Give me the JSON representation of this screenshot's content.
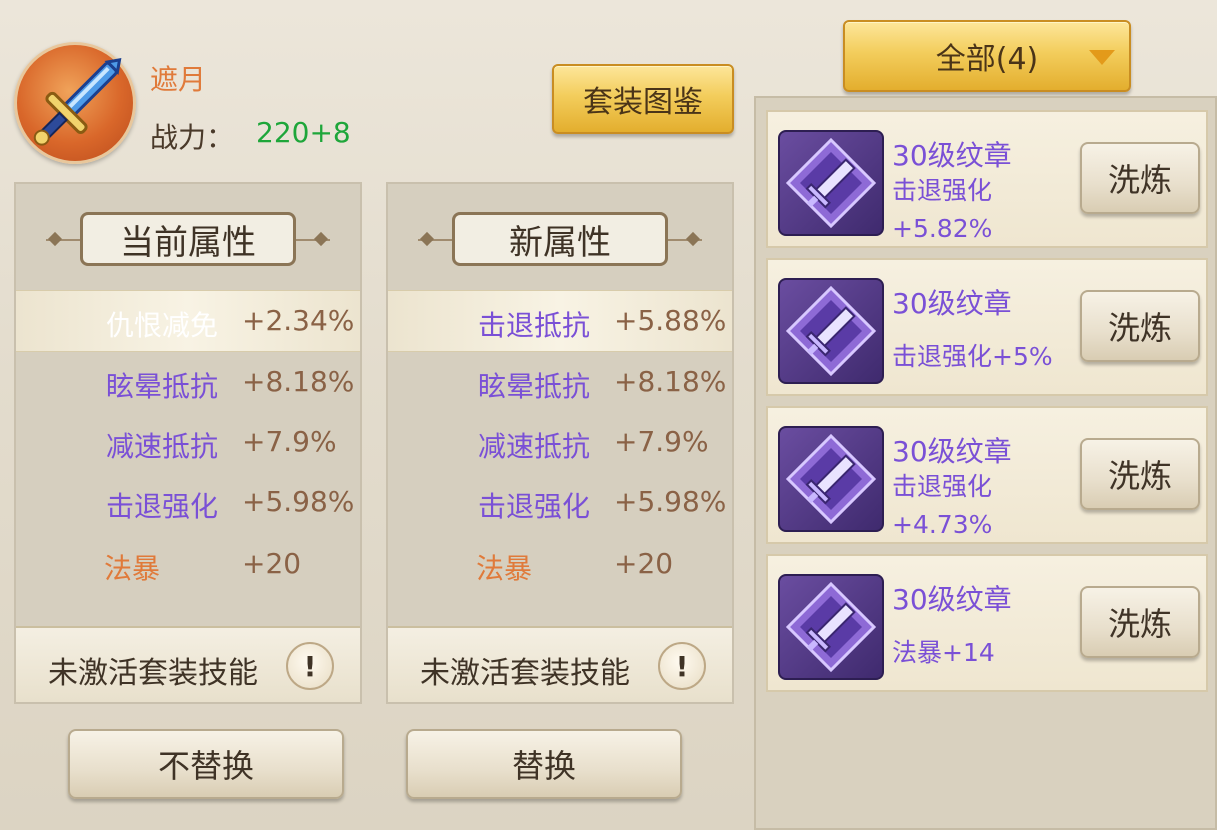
{
  "header": {
    "char_name": "遮月",
    "power_label": "战力：",
    "power_value": "220+8",
    "suit_button": "套装图鉴",
    "filter_label": "全部(4)"
  },
  "panels": {
    "current": {
      "title": "当前属性",
      "attrs": [
        {
          "name": "仇恨减免",
          "value": "+2.34%"
        },
        {
          "name": "眩晕抵抗",
          "value": "+8.18%"
        },
        {
          "name": "减速抵抗",
          "value": "+7.9%"
        },
        {
          "name": "击退强化",
          "value": "+5.98%"
        },
        {
          "name": "法暴",
          "value": "+20"
        }
      ],
      "skill_label": "未激活套装技能",
      "info_glyph": "!"
    },
    "new": {
      "title": "新属性",
      "attrs": [
        {
          "name": "击退抵抗",
          "value": "+5.88%"
        },
        {
          "name": "眩晕抵抗",
          "value": "+8.18%"
        },
        {
          "name": "减速抵抗",
          "value": "+7.9%"
        },
        {
          "name": "击退强化",
          "value": "+5.98%"
        },
        {
          "name": "法暴",
          "value": "+20"
        }
      ],
      "skill_label": "未激活套装技能",
      "info_glyph": "!"
    }
  },
  "buttons": {
    "no_replace": "不替换",
    "replace": "替换"
  },
  "items": [
    {
      "title": "30级纹章",
      "attr": "击退强化+5.82%",
      "button": "洗炼"
    },
    {
      "title": "30级纹章",
      "attr": "击退强化+5%",
      "button": "洗炼"
    },
    {
      "title": "30级纹章",
      "attr": "击退强化+4.73%",
      "button": "洗炼"
    },
    {
      "title": "30级纹章",
      "attr": "法暴+14",
      "button": "洗炼"
    }
  ],
  "colors": {
    "purple": "#7a50d6",
    "orange": "#e07a3a",
    "green": "#1ea63a",
    "gold": "#f3cd5c"
  },
  "icons": {
    "avatar": "sword-icon",
    "item": "emblem-sword-icon"
  }
}
